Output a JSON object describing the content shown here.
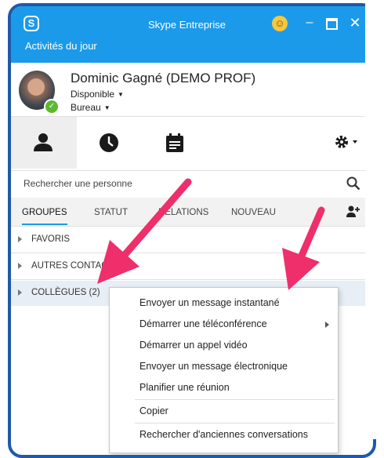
{
  "window": {
    "title": "Skype Entreprise",
    "activities_label": "Activités du jour",
    "minimize_glyph": "–",
    "close_glyph": "✕"
  },
  "profile": {
    "name": "Dominic Gagné (DEMO PROF)",
    "status": "Disponible",
    "location": "Bureau",
    "presence_color": "#5cb82e"
  },
  "toolbar": {
    "icons": [
      "contacts-icon",
      "history-icon",
      "meetings-icon",
      "settings-gear-icon"
    ]
  },
  "search": {
    "placeholder": "Rechercher une personne"
  },
  "tabs": [
    {
      "label": "GROUPES",
      "active": true
    },
    {
      "label": "STATUT",
      "active": false
    },
    {
      "label": "RELATIONS",
      "active": false
    },
    {
      "label": "NOUVEAU",
      "active": false
    }
  ],
  "groups": [
    {
      "label": "FAVORIS"
    },
    {
      "label": "AUTRES CONTACTS"
    },
    {
      "label": "COLLÈGUES (2)"
    }
  ],
  "context_menu": {
    "items": [
      {
        "label": "Envoyer un message instantané",
        "submenu": false
      },
      {
        "label": "Démarrer une téléconférence",
        "submenu": true
      },
      {
        "label": "Démarrer un appel vidéo",
        "submenu": false
      },
      {
        "label": "Envoyer un message électronique",
        "submenu": false
      },
      {
        "label": "Planifier une réunion",
        "submenu": false
      },
      {
        "label": "Copier",
        "submenu": false
      },
      {
        "label": "Rechercher d'anciennes conversations",
        "submenu": false
      }
    ]
  },
  "colors": {
    "accent": "#1b9aea",
    "frame": "#1d5aa8",
    "annotation_arrow": "#ee2f6b"
  }
}
